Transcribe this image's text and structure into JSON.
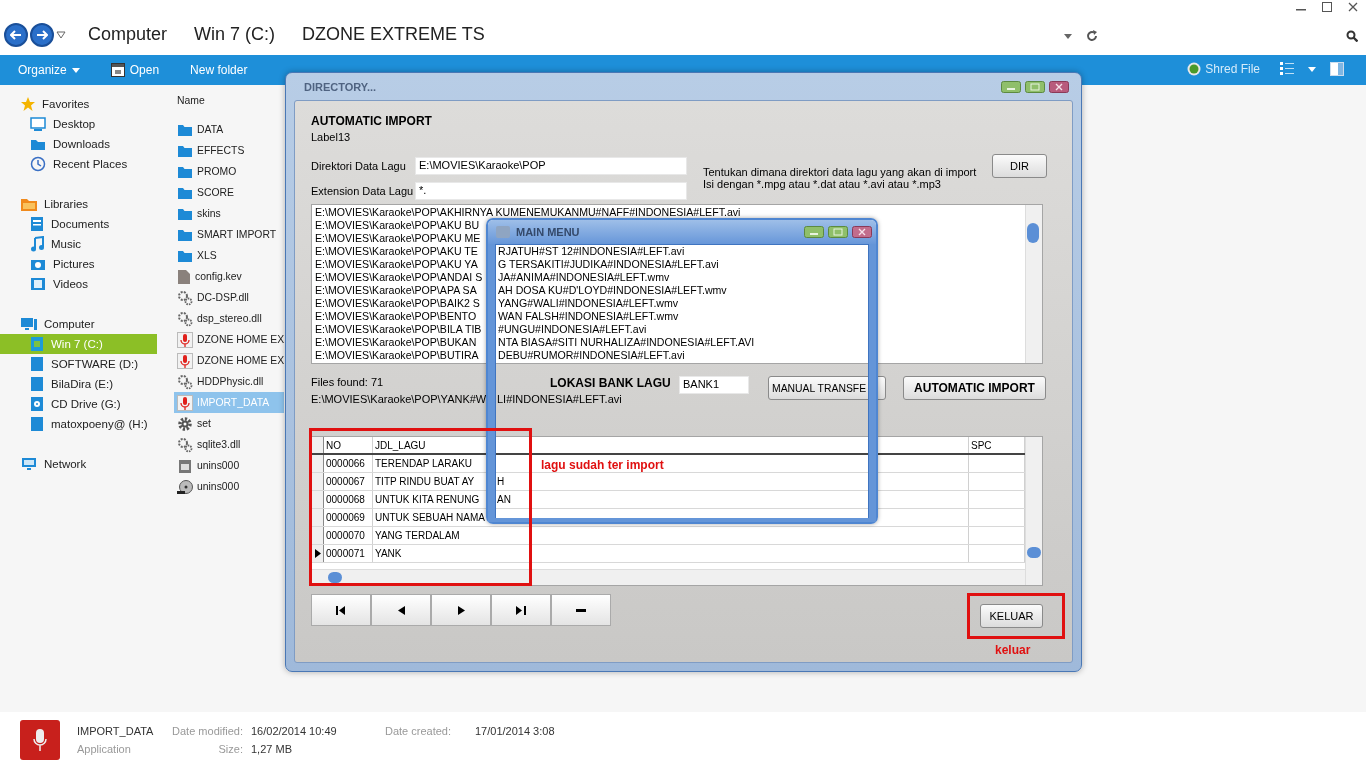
{
  "explorer": {
    "breadcrumb": [
      "Computer",
      "Win 7 (C:)",
      "DZONE EXTREME TS"
    ],
    "toolbar": {
      "organize": "Organize",
      "open": "Open",
      "new_folder": "New folder",
      "shred": "Shred File"
    },
    "sidebar": [
      {
        "label": "Favorites",
        "kind": "star",
        "items": [
          {
            "label": "Desktop",
            "kind": "desktop",
            "selected": false
          },
          {
            "label": "Downloads",
            "kind": "downloads",
            "selected": false
          },
          {
            "label": "Recent Places",
            "kind": "recent",
            "selected": false
          }
        ]
      },
      {
        "label": "Libraries",
        "kind": "library",
        "items": [
          {
            "label": "Documents",
            "kind": "documents",
            "selected": false
          },
          {
            "label": "Music",
            "kind": "music",
            "selected": false
          },
          {
            "label": "Pictures",
            "kind": "pictures",
            "selected": false
          },
          {
            "label": "Videos",
            "kind": "videos",
            "selected": false
          }
        ]
      },
      {
        "label": "Computer",
        "kind": "computer",
        "items": [
          {
            "label": "Win 7 (C:)",
            "kind": "windrive",
            "selected": true
          },
          {
            "label": "SOFTWARE (D:)",
            "kind": "drive",
            "selected": false
          },
          {
            "label": "BilaDira (E:)",
            "kind": "drive",
            "selected": false
          },
          {
            "label": "CD Drive (G:)",
            "kind": "cd",
            "selected": false
          },
          {
            "label": "matoxpoeny@ (H:)",
            "kind": "drive",
            "selected": false
          }
        ]
      },
      {
        "label": "Network",
        "kind": "network"
      }
    ],
    "column_header": "Name",
    "files": [
      {
        "name": "DATA",
        "kind": "folder",
        "selected": false
      },
      {
        "name": "EFFECTS",
        "kind": "folder",
        "selected": false
      },
      {
        "name": "PROMO",
        "kind": "folder",
        "selected": false
      },
      {
        "name": "SCORE",
        "kind": "folder",
        "selected": false
      },
      {
        "name": "skins",
        "kind": "folder",
        "selected": false
      },
      {
        "name": "SMART IMPORT",
        "kind": "folder",
        "selected": false
      },
      {
        "name": "XLS",
        "kind": "folder",
        "selected": false
      },
      {
        "name": "config.kev",
        "kind": "file",
        "selected": false
      },
      {
        "name": "DC-DSP.dll",
        "kind": "dll",
        "selected": false
      },
      {
        "name": "dsp_stereo.dll",
        "kind": "dll",
        "selected": false
      },
      {
        "name": "DZONE HOME EX",
        "kind": "mic",
        "selected": false
      },
      {
        "name": "DZONE HOME EX",
        "kind": "mic",
        "selected": false
      },
      {
        "name": "HDDPhysic.dll",
        "kind": "dll",
        "selected": false
      },
      {
        "name": "IMPORT_DATA",
        "kind": "mic",
        "selected": true
      },
      {
        "name": "set",
        "kind": "gear",
        "selected": false
      },
      {
        "name": "sqlite3.dll",
        "kind": "dll",
        "selected": false
      },
      {
        "name": "unins000",
        "kind": "setup",
        "selected": false
      },
      {
        "name": "unins000",
        "kind": "disc",
        "selected": false
      }
    ],
    "details": {
      "name": "IMPORT_DATA",
      "type": "Application",
      "modified_label": "Date modified:",
      "modified": "16/02/2014 10:49",
      "size_label": "Size:",
      "size": "1,27 MB",
      "created_label": "Date created:",
      "created": "17/01/2014 3:08"
    }
  },
  "directory_window": {
    "title": "DIRECTORY...",
    "heading": "AUTOMATIC IMPORT",
    "label": "Label13",
    "fields": [
      {
        "label": "Direktori Data Lagu",
        "value": "E:\\MOVIES\\Karaoke\\POP"
      },
      {
        "label": "Extension Data Lagu",
        "value": "*."
      }
    ],
    "hints": [
      "Tentukan dimana direktori data lagu yang akan di import",
      "Isi dengan *.mpg atau *.dat atau *.avi atau *.mp3"
    ],
    "dir_button": "DIR",
    "file_lines": [
      {
        "text": "E:\\MOVIES\\Karaoke\\POP\\AKHIRNYA KUMENEMUKANMU#NAFF#INDONESIA#LEFT.avi"
      },
      {
        "text": "E:\\MOVIES\\Karaoke\\POP\\AKU BU"
      },
      {
        "text": "E:\\MOVIES\\Karaoke\\POP\\AKU ME"
      },
      {
        "text": "E:\\MOVIES\\Karaoke\\POP\\AKU TE",
        "rest": "RJATUH#ST 12#INDONESIA#LEFT.avi"
      },
      {
        "text": "E:\\MOVIES\\Karaoke\\POP\\AKU YA",
        "rest": "G TERSAKITI#JUDIKA#INDONESIA#LEFT.avi"
      },
      {
        "text": "E:\\MOVIES\\Karaoke\\POP\\ANDAI S",
        "rest": "JA#ANIMA#INDONESIA#LEFT.wmv"
      },
      {
        "text": "E:\\MOVIES\\Karaoke\\POP\\APA SA",
        "rest": "AH DOSA KU#D'LOYD#INDONESIA#LEFT.wmv"
      },
      {
        "text": "E:\\MOVIES\\Karaoke\\POP\\BAIK2 S",
        "rest": "YANG#WALI#INDONESIA#LEFT.wmv"
      },
      {
        "text": "E:\\MOVIES\\Karaoke\\POP\\BENTO",
        "rest": "WAN FALSH#INDONESIA#LEFT.wmv"
      },
      {
        "text": "E:\\MOVIES\\Karaoke\\POP\\BILA TIB",
        "rest": "#UNGU#INDONESIA#LEFT.avi"
      },
      {
        "text": "E:\\MOVIES\\Karaoke\\POP\\BUKAN",
        "rest": "NTA BIASA#SITI NURHALIZA#INDONESIA#LEFT.AVI"
      },
      {
        "text": "E:\\MOVIES\\Karaoke\\POP\\BUTIRA",
        "rest": "DEBU#RUMOR#INDONESIA#LEFT.avi"
      }
    ],
    "files_found": "Files found: 71",
    "current_path": {
      "text": "E:\\MOVIES\\Karaoke\\POP\\YANK#W",
      "rest": "LI#INDONESIA#LEFT.avi"
    },
    "bank_label": "LOKASI BANK LAGU",
    "bank_value": "BANK1",
    "manual_button": "MANUAL TRANSFE",
    "auto_button": "AUTOMATIC IMPORT",
    "table": {
      "columns": [
        "NO",
        "JDL_LAGU",
        "SPC"
      ],
      "rows": [
        {
          "no": "0000066",
          "title": "TERENDAP LARAKU",
          "current": false
        },
        {
          "no": "0000067",
          "title": "TITP RINDU BUAT AY",
          "rest": "H",
          "current": false
        },
        {
          "no": "0000068",
          "title": "UNTUK KITA RENUNG",
          "rest": "AN",
          "current": false
        },
        {
          "no": "0000069",
          "title": "UNTUK SEBUAH NAMA",
          "current": false
        },
        {
          "no": "0000070",
          "title": "YANG TERDALAM",
          "current": false
        },
        {
          "no": "0000071",
          "title": "YANK",
          "current": true
        }
      ]
    },
    "nav_buttons": [
      {
        "kind": "first"
      },
      {
        "kind": "prev"
      },
      {
        "kind": "next"
      },
      {
        "kind": "last"
      },
      {
        "kind": "delete"
      }
    ],
    "exit_button": "KELUAR"
  },
  "main_menu_window": {
    "title": "MAIN MENU"
  },
  "annotations": [
    {
      "kind": "table",
      "text": "lagu sudah ter import"
    },
    {
      "kind": "exit",
      "text": "keluar"
    }
  ]
}
